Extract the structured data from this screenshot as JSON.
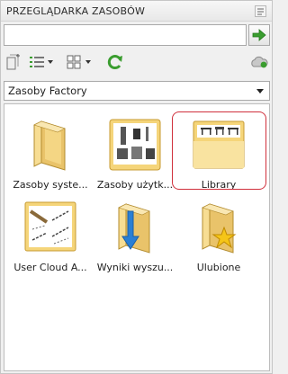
{
  "panel": {
    "title": "PRZEGLĄDARKA ZASOBÓW"
  },
  "search": {
    "value": "",
    "placeholder": ""
  },
  "toolbar": {
    "buttons": [
      "new-folder-icon",
      "list-view-icon",
      "thumbnail-view-icon",
      "refresh-icon",
      "cloud-icon"
    ]
  },
  "source_select": {
    "selected": "Zasoby Factory"
  },
  "tiles": [
    {
      "label": "Zasoby syste...",
      "icon": "system-folder-icon"
    },
    {
      "label": "Zasoby użytk...",
      "icon": "user-resources-folder-icon"
    },
    {
      "label": "Library",
      "icon": "library-folder-icon",
      "selected": true
    },
    {
      "label": "User Cloud A...",
      "icon": "user-cloud-folder-icon"
    },
    {
      "label": "Wyniki wyszu...",
      "icon": "search-results-folder-icon"
    },
    {
      "label": "Ulubione",
      "icon": "favorites-folder-icon"
    }
  ],
  "colors": {
    "accent_green": "#3a9d2f",
    "selection_red": "#d0303c",
    "folder_yellow": "#f5d57a"
  }
}
